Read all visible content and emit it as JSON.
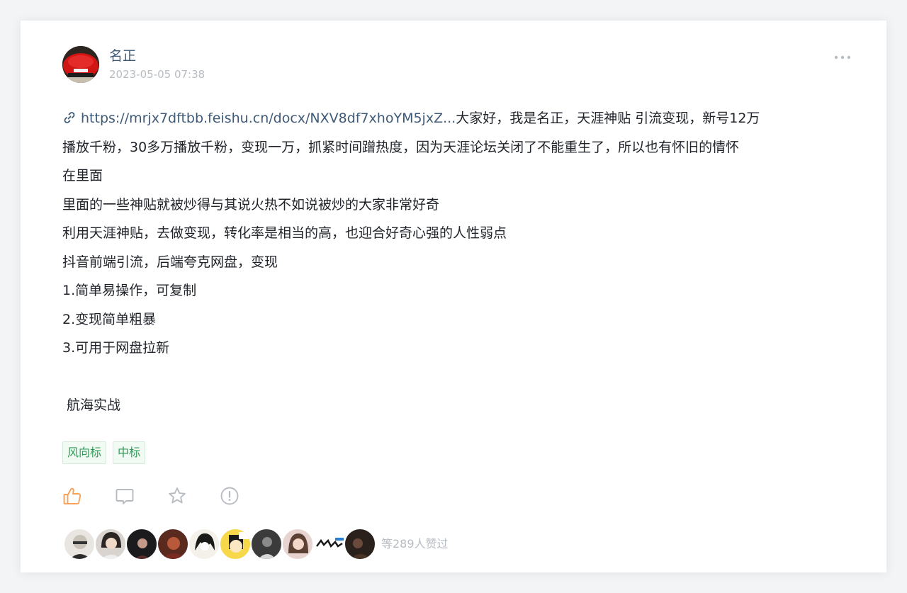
{
  "post": {
    "author": "名正",
    "timestamp": "2023-05-05 07:38",
    "link_text": "https://mrjx7dftbb.feishu.cn/docx/NXV8df7xhoYM5jxZ...",
    "intro_rest": "大家好，我是名正，天涯神贴 引流变现，新号12万",
    "line2": "播放千粉，30多万播放千粉，变现一万，抓紧时间蹭热度，因为天涯论坛关闭了不能重生了，所以也有怀旧的情怀",
    "line3": "在里面",
    "line4": "里面的一些神贴就被炒得与其说火热不如说被炒的大家非常好奇",
    "line5": "利用天涯神贴，去做变现，转化率是相当的高，也迎合好奇心强的人性弱点",
    "line6": "抖音前端引流，后端夸克网盘，变现",
    "line7": "1.简单易操作，可复制",
    "line8": "2.变现简单粗暴",
    "line9": "3.可用于网盘拉新",
    "line11": " 航海实战"
  },
  "tags": [
    "风向标",
    "中标"
  ],
  "actions": {
    "like_icon": "thumbs-up-icon",
    "comment_icon": "comment-icon",
    "favorite_icon": "star-icon",
    "report_icon": "alert-circle-icon",
    "like_active_color": "#f5a35c"
  },
  "likers": {
    "summary": "等289人赞过"
  },
  "colors": {
    "link": "#3e5a77",
    "muted": "#b7bcc3",
    "tag_text": "#2e9a56",
    "text": "#1f2329"
  }
}
